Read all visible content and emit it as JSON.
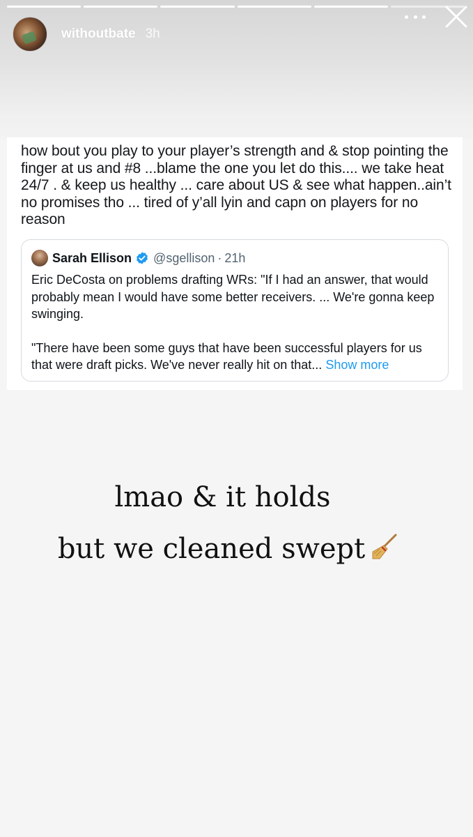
{
  "story": {
    "progress_segments": [
      1,
      1,
      1,
      1,
      1,
      0.0
    ],
    "username": "withoutbate",
    "time": "3h"
  },
  "tweet": {
    "text": "how bout you play to your player’s strength and & stop pointing the finger at us and #8 ...blame the one you let do this.... we take heat 24/7 . & keep us healthy ... care about US & see what happen..ain’t no promises tho ... tired of y’all lyin and capn on players for no reason",
    "quote": {
      "name": "Sarah Ellison",
      "handle": "@sgellison",
      "separator": "·",
      "time": "21h",
      "paragraph_1": "Eric DeCosta on problems drafting WRs: \"If I had an answer, that would probably mean I would have some better receivers. ... We're gonna keep swinging.",
      "paragraph_2": "\"There have been some guys that have been successful players for us that were draft picks. We've never really hit on that...",
      "show_more": "Show more"
    }
  },
  "caption": {
    "line_1": "lmao & it holds",
    "line_2": "but we cleaned swept"
  },
  "icons": {
    "more": "more-dots-icon",
    "close": "close-icon",
    "verified": "verified-badge-icon",
    "broom": "broom-icon"
  },
  "colors": {
    "verified": "#1d9bf0",
    "show_more": "#1d9bf0"
  }
}
